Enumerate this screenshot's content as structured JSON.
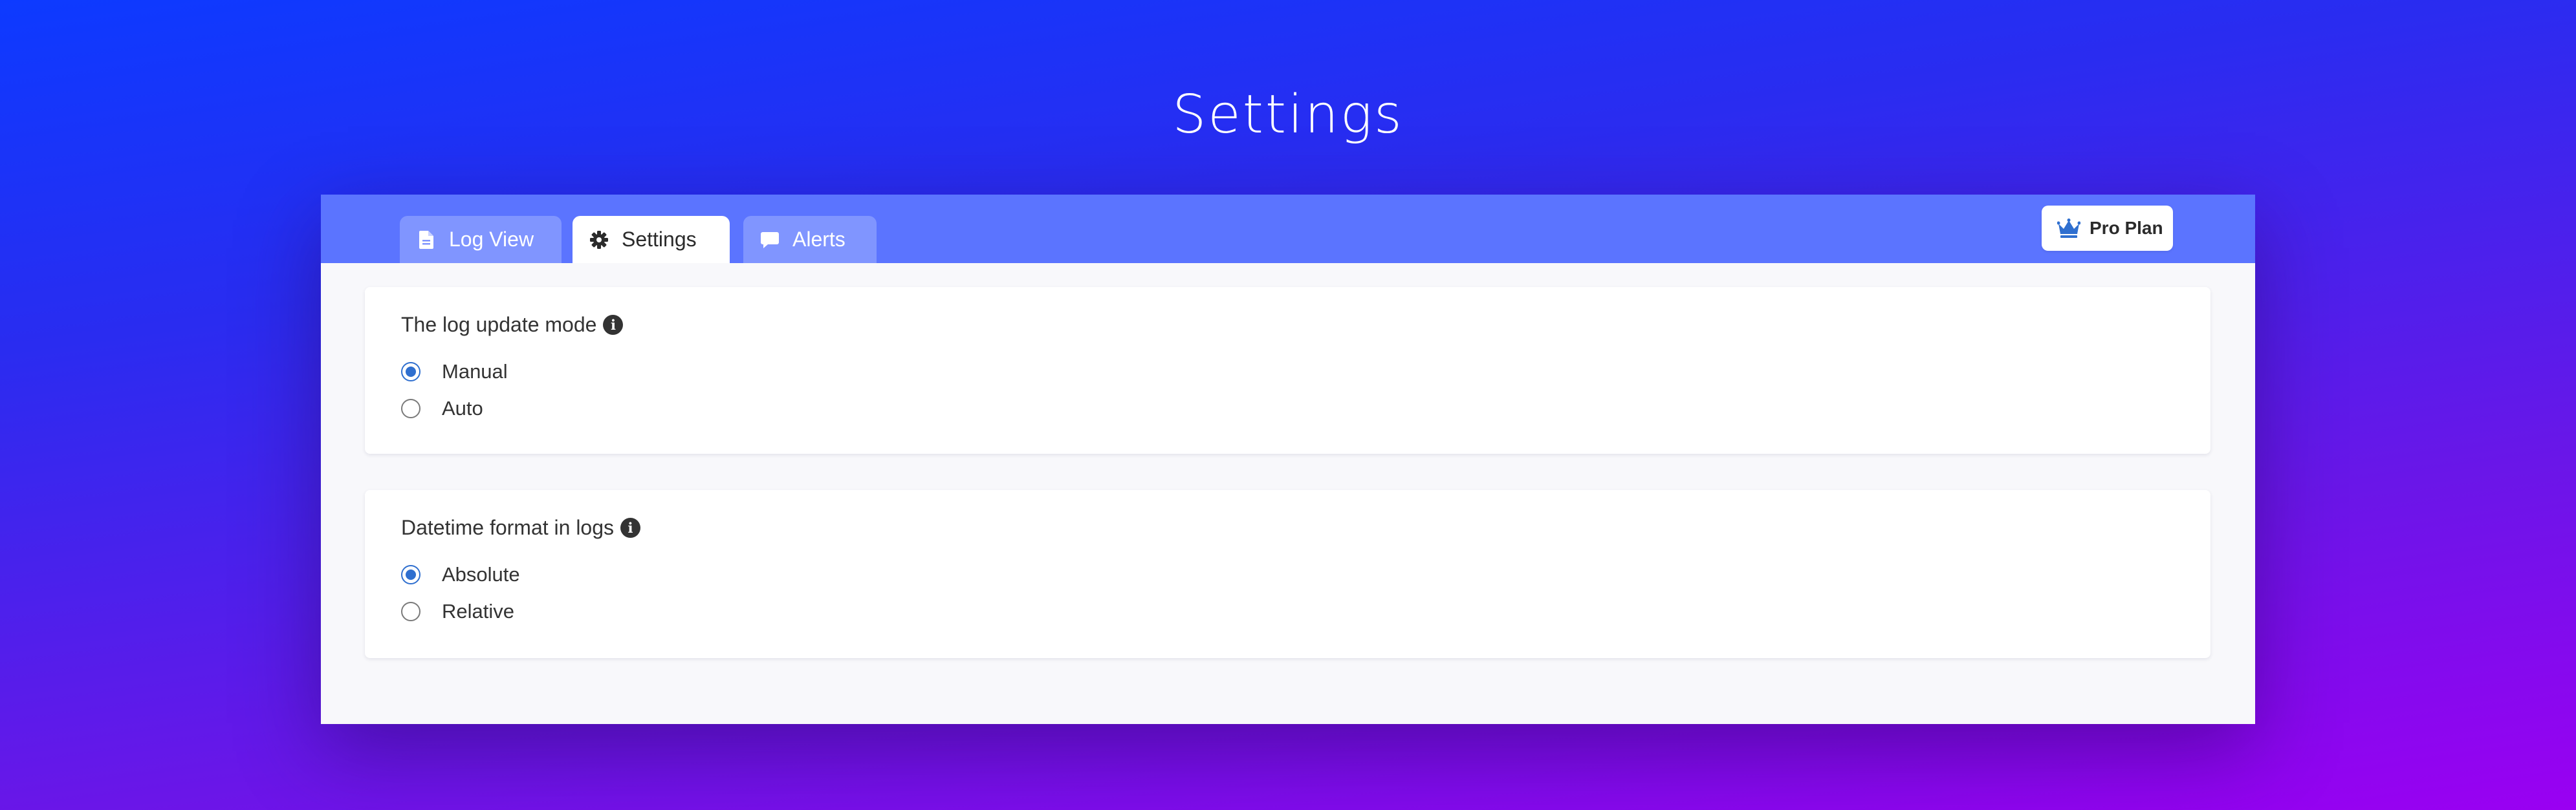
{
  "page": {
    "title": "Settings"
  },
  "tabs": [
    {
      "label": "Log View",
      "icon": "document-icon",
      "active": false
    },
    {
      "label": "Settings",
      "icon": "gear-icon",
      "active": true
    },
    {
      "label": "Alerts",
      "icon": "comment-icon",
      "active": false
    }
  ],
  "plan_button": {
    "label": "Pro Plan",
    "icon": "crown-icon"
  },
  "sections": [
    {
      "title": "The log update mode",
      "info_icon": "info-icon",
      "options": [
        {
          "label": "Manual",
          "selected": true
        },
        {
          "label": "Auto",
          "selected": false
        }
      ]
    },
    {
      "title": "Datetime format in logs",
      "info_icon": "info-icon",
      "options": [
        {
          "label": "Absolute",
          "selected": true
        },
        {
          "label": "Relative",
          "selected": false
        }
      ]
    }
  ],
  "colors": {
    "background_top": "#0d3aff",
    "background_bottom": "#9a00f2",
    "tabbar": "#5b74ff",
    "inactive_tab": "#8095ff",
    "radio_selected": "#2f6fcf",
    "crown": "#2f6fcf"
  }
}
